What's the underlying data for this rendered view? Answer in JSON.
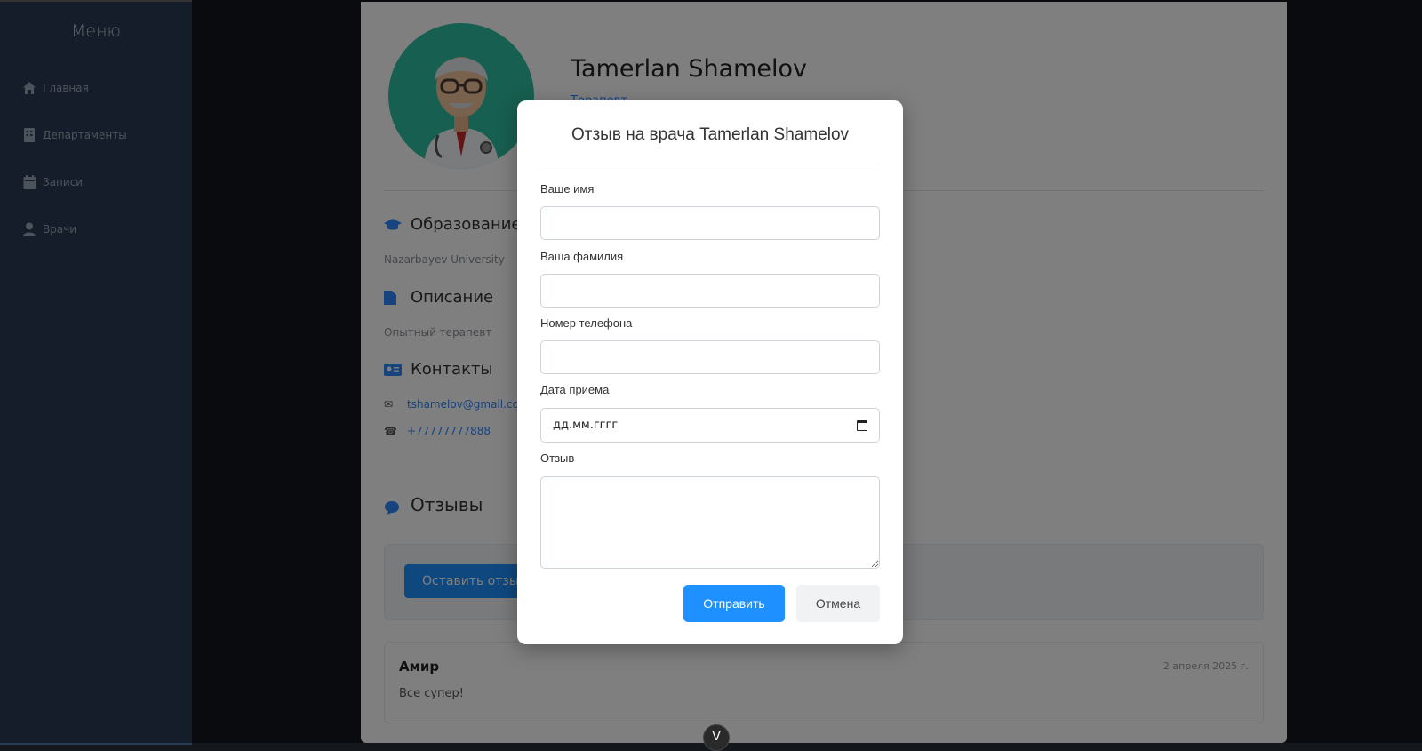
{
  "sidebar": {
    "title": "Меню",
    "items": [
      {
        "label": "Главная",
        "icon": "home-icon"
      },
      {
        "label": "Департаменты",
        "icon": "building-icon"
      },
      {
        "label": "Записи",
        "icon": "calendar-icon"
      },
      {
        "label": "Врачи",
        "icon": "user-icon"
      }
    ]
  },
  "doctor": {
    "name": "Tamerlan Shamelov",
    "subtitle": "Терапевт",
    "sections": {
      "education": {
        "title": "Образование",
        "text": "Nazarbayev University"
      },
      "description": {
        "title": "Описание",
        "text": "Опытный терапевт"
      },
      "contacts": {
        "title": "Контакты",
        "email": "tshamelov@gmail.com",
        "phone": "+77777777888"
      }
    }
  },
  "reviews": {
    "title": "Отзывы",
    "leave_button": "Оставить отзыв",
    "items": [
      {
        "author": "Амир",
        "text": "Все супер!",
        "date": "2 апреля 2025 г."
      }
    ]
  },
  "modal": {
    "title": "Отзыв на врача Tamerlan Shamelov",
    "fields": {
      "first_name": {
        "label": "Ваше имя",
        "value": ""
      },
      "last_name": {
        "label": "Ваша фамилия",
        "value": ""
      },
      "phone": {
        "label": "Номер телефона",
        "value": ""
      },
      "date": {
        "label": "Дата приема",
        "placeholder": "дд.мм.гггг"
      },
      "review": {
        "label": "Отзыв",
        "value": ""
      }
    },
    "submit_label": "Отправить",
    "cancel_label": "Отмена"
  },
  "scroll_button": "V",
  "colors": {
    "accent": "#1e90ff",
    "sidebar": "#2a3b54",
    "avatar_bg": "#2fbfa0"
  }
}
